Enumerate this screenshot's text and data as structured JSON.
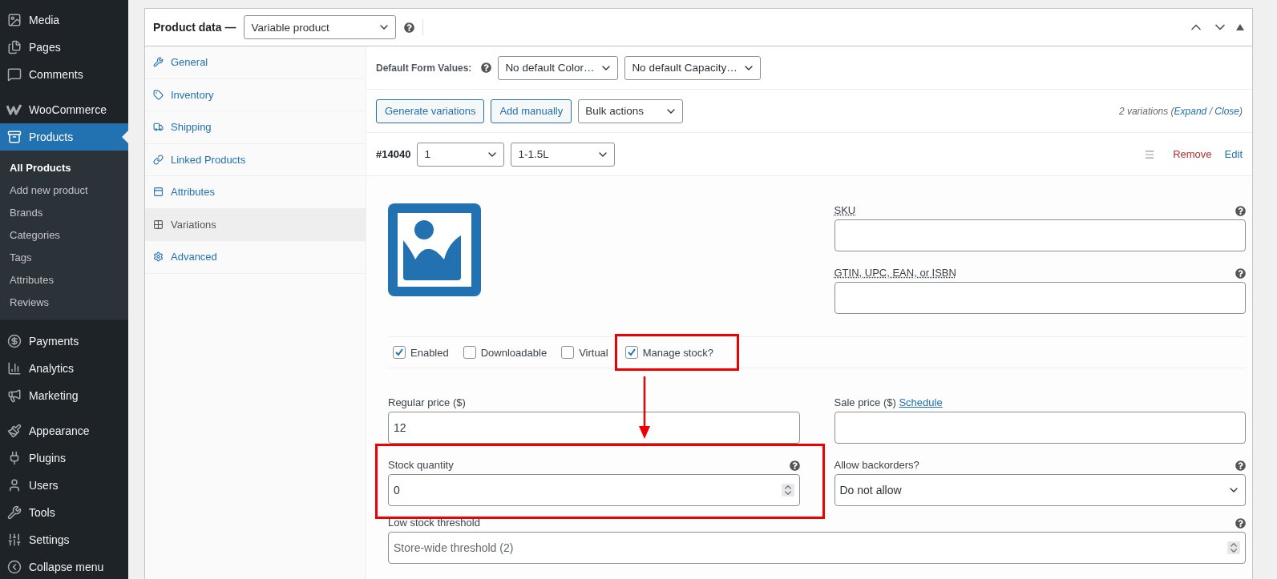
{
  "sidebar": {
    "groups": [
      [
        {
          "label": "Media",
          "selected": false
        },
        {
          "label": "Pages",
          "selected": false
        },
        {
          "label": "Comments",
          "selected": false
        }
      ],
      [
        {
          "label": "WooCommerce",
          "selected": false
        },
        {
          "label": "Products",
          "selected": true,
          "children": [
            {
              "label": "All Products",
              "selected": true
            },
            {
              "label": "Add new product",
              "selected": false
            },
            {
              "label": "Brands",
              "selected": false
            },
            {
              "label": "Categories",
              "selected": false
            },
            {
              "label": "Tags",
              "selected": false
            },
            {
              "label": "Attributes",
              "selected": false
            },
            {
              "label": "Reviews",
              "selected": false
            }
          ]
        }
      ],
      [
        {
          "label": "Payments",
          "selected": false
        },
        {
          "label": "Analytics",
          "selected": false
        },
        {
          "label": "Marketing",
          "selected": false
        }
      ],
      [
        {
          "label": "Appearance",
          "selected": false
        },
        {
          "label": "Plugins",
          "selected": false
        },
        {
          "label": "Users",
          "selected": false
        },
        {
          "label": "Tools",
          "selected": false
        },
        {
          "label": "Settings",
          "selected": false
        },
        {
          "label": "Collapse menu",
          "selected": false
        }
      ]
    ]
  },
  "product_data": {
    "title": "Product data —",
    "type": "Variable product",
    "tabs": [
      {
        "label": "General",
        "selected": false
      },
      {
        "label": "Inventory",
        "selected": false
      },
      {
        "label": "Shipping",
        "selected": false
      },
      {
        "label": "Linked Products",
        "selected": false
      },
      {
        "label": "Attributes",
        "selected": false
      },
      {
        "label": "Variations",
        "selected": true
      },
      {
        "label": "Advanced",
        "selected": false
      }
    ],
    "default_form": {
      "label": "Default Form Values:",
      "selects": [
        "No default Color…",
        "No default Capacity…"
      ]
    },
    "actions": {
      "buttons": [
        "Generate variations",
        "Add manually"
      ],
      "bulk": "Bulk actions",
      "summary": {
        "prefix": "2 variations (",
        "expand": "Expand",
        "separator": " / ",
        "close": "Close",
        "suffix": ")"
      }
    },
    "variation": {
      "id": "#14040",
      "selects": [
        "1",
        "1-1.5L"
      ],
      "remove": "Remove",
      "edit": "Edit",
      "sku": {
        "label": "SKU"
      },
      "gtin": {
        "label": "GTIN, UPC, EAN, or ISBN"
      },
      "checkboxes": [
        {
          "label": "Enabled",
          "checked": true,
          "highlighted": false
        },
        {
          "label": "Downloadable",
          "checked": false,
          "highlighted": false
        },
        {
          "label": "Virtual",
          "checked": false,
          "highlighted": false
        },
        {
          "label": "Manage stock?",
          "checked": true,
          "highlighted": true
        }
      ],
      "regular_price": {
        "label": "Regular price ($)",
        "value": "12"
      },
      "sale_price": {
        "label": "Sale price ($)",
        "link": "Schedule"
      },
      "stock_quantity": {
        "label": "Stock quantity",
        "value": "0",
        "highlighted": true
      },
      "backorders": {
        "label": "Allow backorders?",
        "value": "Do not allow"
      },
      "low_stock": {
        "label": "Low stock threshold",
        "placeholder": "Store-wide threshold (2)"
      }
    }
  }
}
